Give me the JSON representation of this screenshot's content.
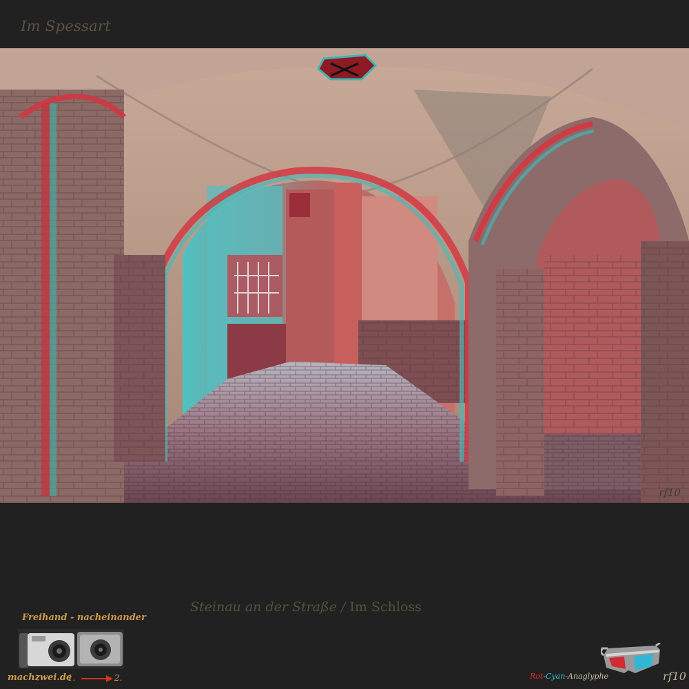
{
  "header": {
    "title": "Im Spessart"
  },
  "photo": {
    "signature": "rf10",
    "icon": "anaglyph-photo-castle-archway"
  },
  "caption": {
    "place": "Steinau an der Straße",
    "separator": "/",
    "subject": "Im Schloss"
  },
  "badge_left": {
    "method": "Freihand - nacheinander",
    "site": "machzwei.de",
    "step1": "1.",
    "step2": "2.",
    "icon": "two-camera-icon",
    "arrow_color": "#d0361c"
  },
  "badge_right": {
    "red_word": "Rot",
    "dash1": "-",
    "cyan_word": "Cyan",
    "rest": "-Anaglyphe",
    "author": "rf10",
    "icon": "3d-glasses-icon",
    "colors": {
      "red": "#e0252a",
      "cyan": "#2fc4d8",
      "text": "#c9c0ae"
    }
  },
  "colors": {
    "background": "#212121",
    "header_text": "#5b5445",
    "caption_text": "#57503f",
    "badge_text": "#cf9a4b"
  }
}
